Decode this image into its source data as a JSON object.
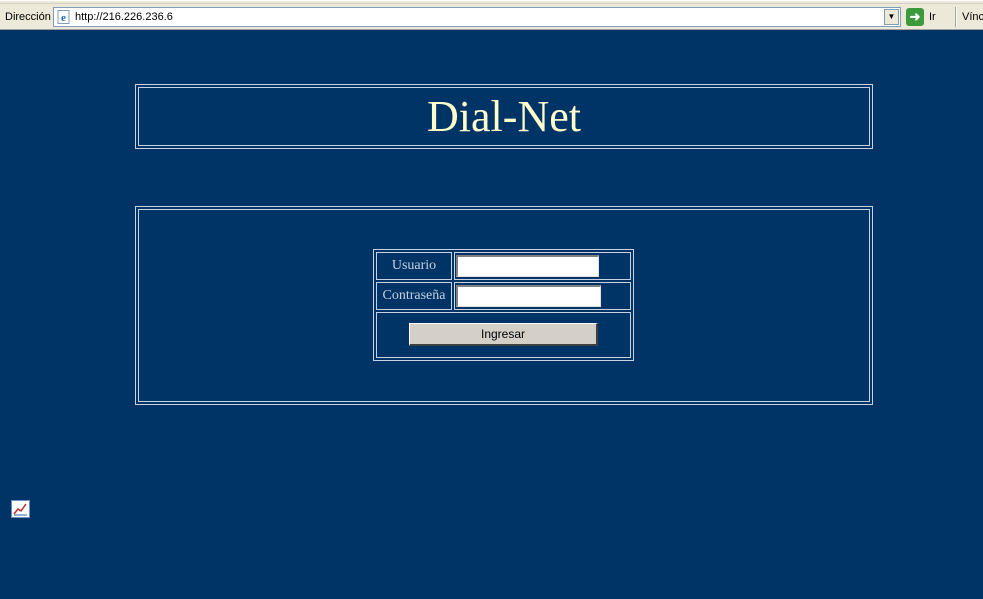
{
  "browser": {
    "address_label": "Dirección",
    "url": "http://216.226.236.6",
    "go_label": "Ir",
    "links_label": "Vínc"
  },
  "page": {
    "title": "Dial-Net",
    "login": {
      "user_label": "Usuario",
      "user_value": "",
      "password_label": "Contraseña",
      "password_value": "",
      "submit_label": "Ingresar"
    }
  },
  "colors": {
    "background": "#003366",
    "title_text": "#ffffcc",
    "label_text": "#c8d2e0"
  },
  "icons": {
    "address_icon": "ie-page-icon",
    "go_icon": "go-arrow-icon",
    "corner_icon": "stats-chart-icon"
  }
}
